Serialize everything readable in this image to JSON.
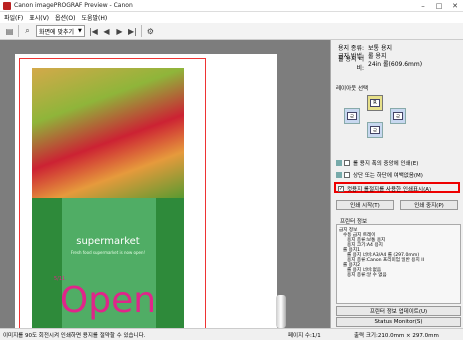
{
  "window": {
    "title": "Canon imagePROGRAF Preview - Canon"
  },
  "menu": [
    "파일(F)",
    "표시(V)",
    "옵션(O)",
    "도움말(H)"
  ],
  "toolbar": {
    "zoom_value": "화면에 맞추기"
  },
  "preview": {
    "supermarket": "supermarket",
    "tagline": "Fresh food supermarket is now open!",
    "date": "5/11",
    "open": "Open"
  },
  "info": {
    "rows": [
      {
        "k": "용지 종류:",
        "v": "보통 용지"
      },
      {
        "k": "급지 방법:",
        "v": "롤 용지"
      },
      {
        "k": "롤 용지 너비:",
        "v": "24in 롤(609.6mm)"
      }
    ]
  },
  "layout": {
    "label": "레이아웃 선택"
  },
  "options": {
    "center": "롤 용지 폭의 중앙에 인쇄(E)",
    "nomargin": "상단 또는 하단에 여백없음(M)",
    "cutline": "컷용지 롤절지를 사용한 인쇄표시(A)"
  },
  "buttons": {
    "print_start": "인쇄 시작(T)",
    "print_stop": "인쇄 중지(P)",
    "update": "프린터 정보 업데이트(U)",
    "status": "Status Monitor(S)"
  },
  "printer": {
    "header": "프린터 정보",
    "lines": [
      "급지 정보",
      "수동 급지 트레이",
      "용지 종류:보통 용지",
      "용지 크기:A4 용지",
      "롤 용지1",
      "롤 용지 너비:A3/A4 롤 (297.0mm)",
      "용지 종류:Canon 프리미엄 일반 용지 II",
      "롤 용지2",
      "롤 용지 너비:없음",
      "용지 종류:알 수 없음"
    ]
  },
  "status": {
    "left": "이미지를 90도 회전시켜 인쇄하면 용지를 절약할 수 있습니다.",
    "page": "페이지 수:1/1",
    "size": "출력 크기:210.0mm × 297.0mm"
  }
}
